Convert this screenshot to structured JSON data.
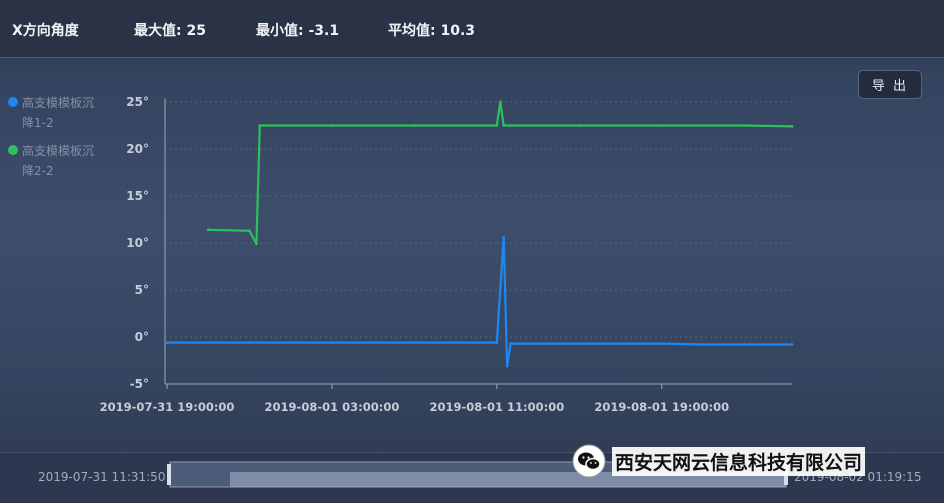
{
  "header": {
    "title": "X方向角度",
    "max_label": "最大值: 25",
    "min_label": "最小值: -3.1",
    "avg_label": "平均值: 10.3"
  },
  "toolbar": {
    "export_label": "导 出"
  },
  "legend": [
    {
      "label": "高支模模板沉降1-2",
      "color": "#1e88f0"
    },
    {
      "label": "高支模模板沉降2-2",
      "color": "#2cc15a"
    }
  ],
  "slider": {
    "start_label": "2019-07-31 11:31:50",
    "end_label": "2019-08-02 01:19:15"
  },
  "watermark": {
    "text": "西安天网云信息科技有限公司"
  },
  "chart_data": {
    "type": "line",
    "title": "",
    "xlabel": "",
    "ylabel": "",
    "ylim": [
      -5,
      25
    ],
    "y_ticks": [
      "-5°",
      "0°",
      "5°",
      "10°",
      "15°",
      "20°",
      "25°"
    ],
    "x_ticks": [
      "2019-07-31 19:00:00",
      "2019-08-01 03:00:00",
      "2019-08-01 11:00:00",
      "2019-08-01 19:00:00"
    ],
    "xlim": [
      "2019-07-31 19:00:00",
      "2019-08-02 01:19:15"
    ],
    "grid": true,
    "legend_position": "left",
    "series": [
      {
        "name": "高支模模板沉降1-2",
        "color": "#1e88f0",
        "x": [
          "2019-07-31 19:00:00",
          "2019-07-31 23:00:00",
          "2019-08-01 03:00:00",
          "2019-08-01 07:00:00",
          "2019-08-01 11:00:00",
          "2019-08-01 11:20:00",
          "2019-08-01 11:30:00",
          "2019-08-01 11:40:00",
          "2019-08-01 15:00:00",
          "2019-08-01 19:00:00",
          "2019-08-01 21:00:00",
          "2019-08-01 23:00:00",
          "2019-08-02 01:19:15"
        ],
        "y": [
          -0.6,
          -0.6,
          -0.6,
          -0.6,
          -0.6,
          10.6,
          -3.1,
          -0.7,
          -0.7,
          -0.7,
          -0.8,
          -0.8,
          -0.8
        ]
      },
      {
        "name": "高支模模板沉降2-2",
        "color": "#2cc15a",
        "x": [
          "2019-07-31 21:00:00",
          "2019-07-31 23:00:00",
          "2019-07-31 23:20:00",
          "2019-07-31 23:30:00",
          "2019-08-01 03:00:00",
          "2019-08-01 07:00:00",
          "2019-08-01 11:00:00",
          "2019-08-01 11:10:00",
          "2019-08-01 11:20:00",
          "2019-08-01 15:00:00",
          "2019-08-01 19:00:00",
          "2019-08-01 23:00:00",
          "2019-08-02 01:19:15"
        ],
        "y": [
          11.4,
          11.3,
          9.9,
          22.5,
          22.5,
          22.5,
          22.5,
          25.0,
          22.5,
          22.5,
          22.5,
          22.5,
          22.4
        ]
      }
    ]
  }
}
